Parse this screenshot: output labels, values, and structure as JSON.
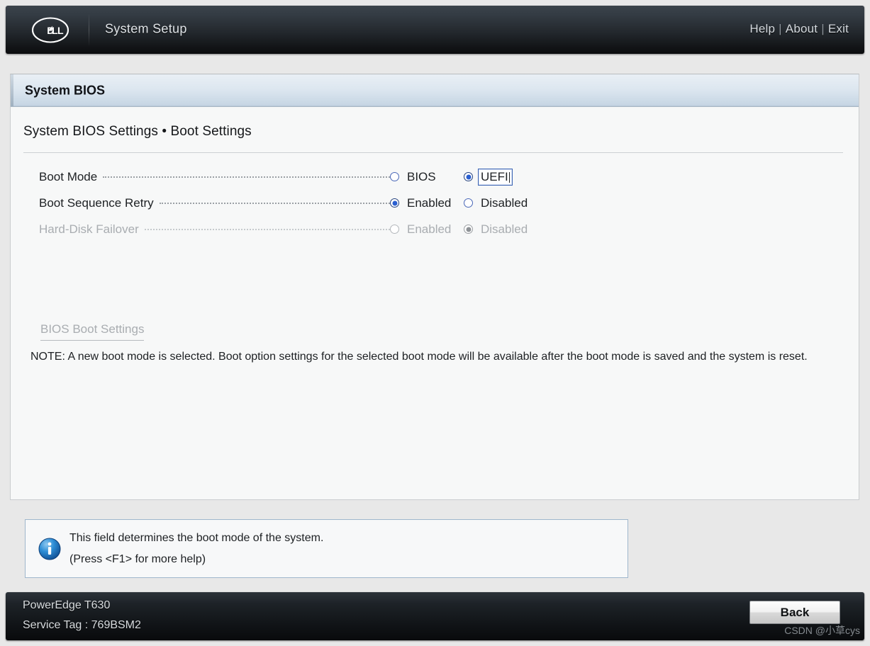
{
  "topbar": {
    "brand": "DELL",
    "brand_icon": "dell-logo-icon",
    "title": "System Setup",
    "nav": [
      {
        "label": "Help"
      },
      {
        "label": "About"
      },
      {
        "label": "Exit"
      }
    ],
    "nav_separator": "|"
  },
  "panel": {
    "header_title": "System BIOS",
    "subtitle": "System BIOS Settings • Boot Settings",
    "rows": [
      {
        "label": "Boot Mode",
        "disabled": false,
        "options": [
          {
            "label": "BIOS",
            "checked": false,
            "focused": false
          },
          {
            "label": "UEFI",
            "checked": true,
            "focused": true
          }
        ]
      },
      {
        "label": "Boot Sequence Retry",
        "disabled": false,
        "options": [
          {
            "label": "Enabled",
            "checked": true,
            "focused": false
          },
          {
            "label": "Disabled",
            "checked": false,
            "focused": false
          }
        ]
      },
      {
        "label": "Hard-Disk Failover",
        "disabled": true,
        "options": [
          {
            "label": "Enabled",
            "checked": false,
            "focused": false
          },
          {
            "label": "Disabled",
            "checked": true,
            "focused": false
          }
        ]
      }
    ],
    "sublink": "BIOS Boot Settings",
    "note": "NOTE: A new boot mode is selected. Boot option settings for the selected boot mode will be available after the boot mode is saved and the system is reset."
  },
  "infobox": {
    "icon": "info-icon",
    "line1": "This field determines the boot mode of the system.",
    "line2": "(Press <F1> for more help)"
  },
  "footer": {
    "model": "PowerEdge T630",
    "service_tag": "Service Tag : 769BSM2",
    "back_label": "Back",
    "watermark": "CSDN @小草cys"
  },
  "colors": {
    "accent_blue": "#2a5fd0",
    "focus_blue": "#3c64b4",
    "panel_header_blue": "#c7d6e4",
    "disabled_grey": "#a9adb1",
    "info_border": "#9fb6cc"
  }
}
